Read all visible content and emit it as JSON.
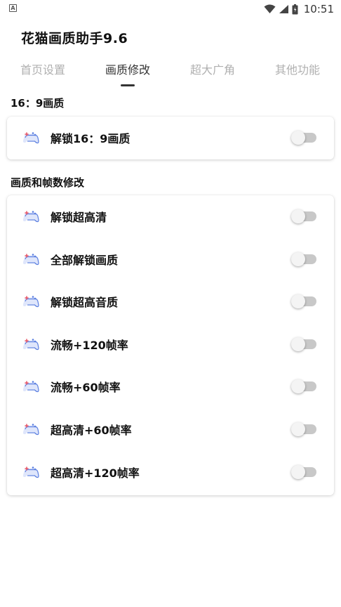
{
  "status_bar": {
    "time": "10:51",
    "left_icon": "A",
    "icons": [
      "wifi-icon",
      "signal-icon",
      "battery-icon"
    ]
  },
  "app": {
    "title": "花猫画质助手9.6"
  },
  "tabs": [
    {
      "label": "首页设置",
      "active": false
    },
    {
      "label": "画质修改",
      "active": true
    },
    {
      "label": "超大广角",
      "active": false
    },
    {
      "label": "其他功能",
      "active": false
    }
  ],
  "sections": [
    {
      "title": "16：9画质",
      "items": [
        {
          "label": "解锁16：9画质",
          "on": false
        }
      ]
    },
    {
      "title": "画质和帧数修改",
      "items": [
        {
          "label": "解锁超高清",
          "on": false
        },
        {
          "label": "全部解锁画质",
          "on": false
        },
        {
          "label": "解锁超高音质",
          "on": false
        },
        {
          "label": "流畅+120帧率",
          "on": false
        },
        {
          "label": "流畅+60帧率",
          "on": false
        },
        {
          "label": "超高清+60帧率",
          "on": false
        },
        {
          "label": "超高清+120帧率",
          "on": false
        }
      ]
    }
  ],
  "colors": {
    "tab_inactive": "#b0b0b0",
    "tab_active": "#333333",
    "switch_off_track": "#c8c8c8",
    "switch_off_thumb": "#f4f4f4",
    "icon_blue": "#5b7fe0",
    "icon_red": "#e85a6a"
  }
}
